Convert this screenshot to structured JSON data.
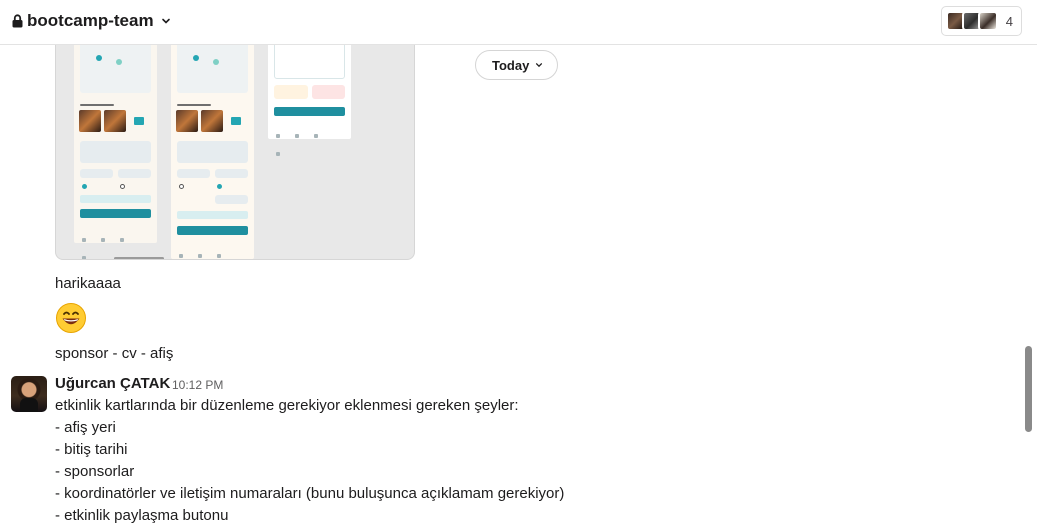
{
  "header": {
    "channel_name": "bootcamp-team",
    "member_count": "4"
  },
  "date_divider": {
    "label": "Today"
  },
  "messages": {
    "m1": "harikaaaa",
    "m2": "sponsor - cv - afiş",
    "post": {
      "author": "Uğurcan ÇATAK",
      "time": "10:12 PM",
      "lines": [
        "etkinlik kartlarında bir düzenleme gerekiyor eklenmesi gereken şeyler:",
        "- afiş yeri",
        "- bitiş tarihi",
        "- sponsorlar",
        "- koordinatörler ve iletişim numaraları (bunu buluşunca açıklamam gerekiyor)",
        "- etkinlik paylaşma butonu"
      ]
    }
  },
  "icons": {
    "lock": "lock-icon",
    "chevron": "chevron-down-icon",
    "emoji": "grinning-face-emoji"
  },
  "colors": {
    "accent_teal": "#1f8f9f",
    "text": "#1d1c1d",
    "muted": "#616061"
  }
}
